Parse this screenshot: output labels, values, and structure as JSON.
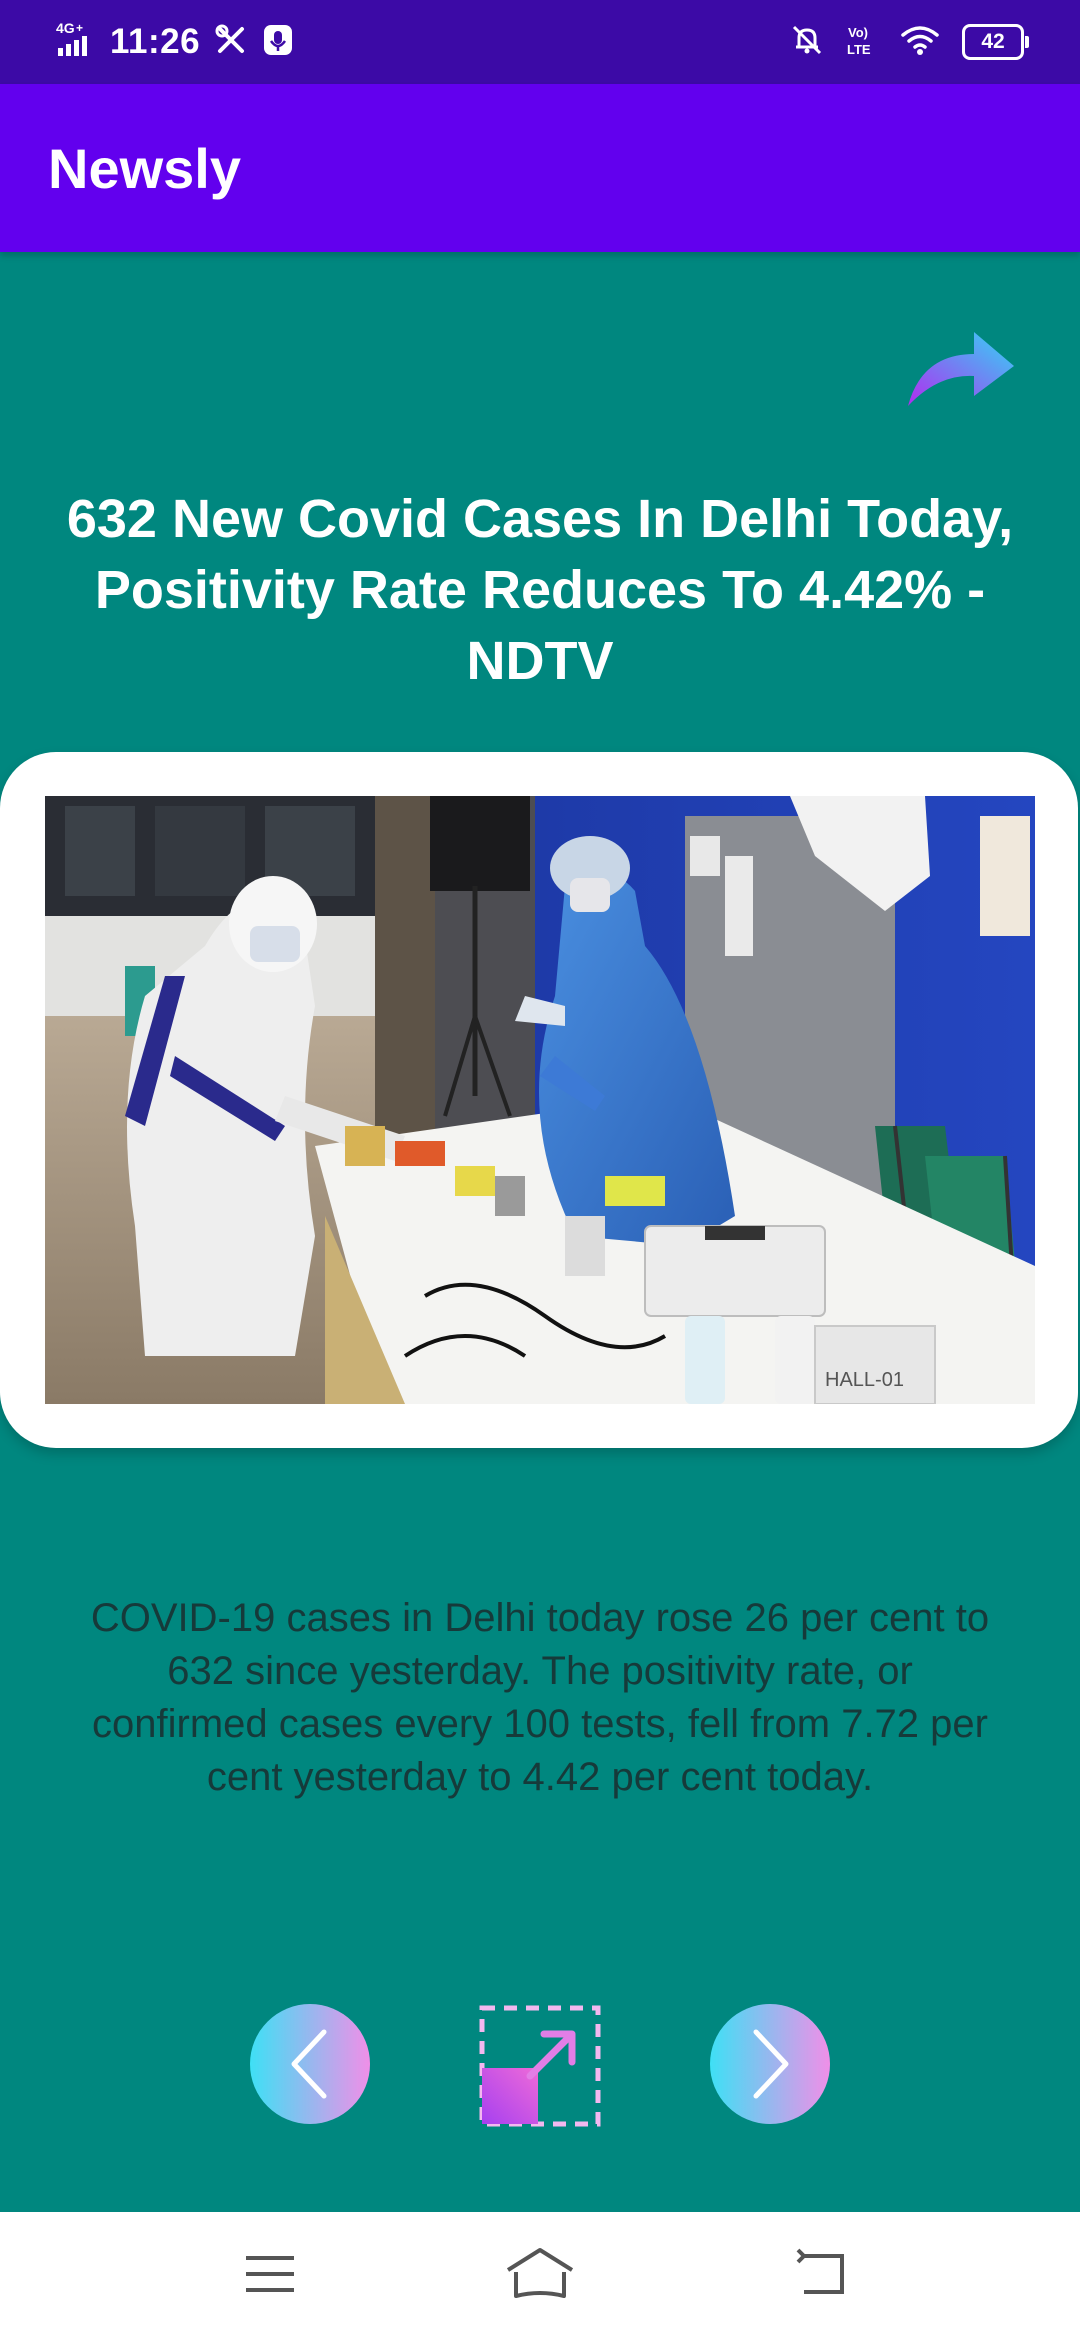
{
  "status_bar": {
    "time": "11:26",
    "network": "4G",
    "battery": "42",
    "icons": [
      "signal-icon",
      "tools-icon",
      "mic-notification-icon",
      "bell-off-icon",
      "volte-icon",
      "wifi-icon",
      "battery-icon"
    ]
  },
  "app_bar": {
    "title": "Newsly"
  },
  "article": {
    "headline": "632 New Covid Cases In Delhi Today, Positivity Rate Reduces To 4.42% - NDTV",
    "description": "COVID-19 cases in Delhi today rose 26 per cent to 632 since yesterday. The positivity rate, or confirmed cases every 100 tests, fell from 7.72 per cent yesterday to 4.42 per cent today.",
    "image_alt": "Health workers in PPE at a covid testing table",
    "image_text": "HALL-01"
  },
  "actions": {
    "share_icon": "share-arrow-icon",
    "previous_icon": "chevron-left-icon",
    "expand_icon": "expand-icon",
    "next_icon": "chevron-right-icon"
  },
  "system_nav": {
    "icons": [
      "menu-icon",
      "home-icon",
      "back-icon"
    ]
  },
  "colors": {
    "status_bar": "#3c0aa6",
    "app_bar": "#6200ee",
    "background": "#00877f",
    "gradient_start": "#3ee0f5",
    "gradient_end": "#f08fe8"
  }
}
